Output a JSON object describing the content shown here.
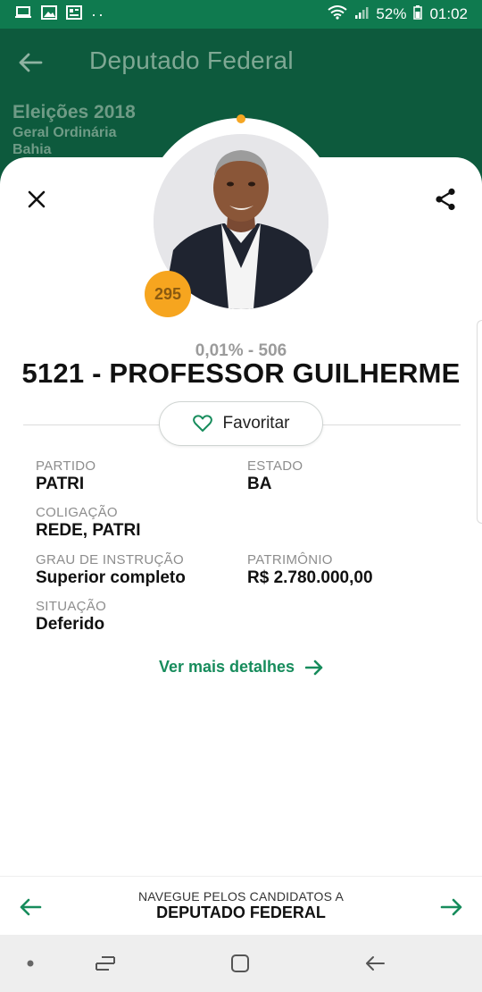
{
  "status_bar": {
    "battery_text": "52%",
    "time": "01:02",
    "icons": [
      "laptop-icon",
      "image-icon",
      "news-icon",
      "more-dots-icon",
      "wifi-icon",
      "signal-icon",
      "battery-icon"
    ]
  },
  "header": {
    "title": "Deputado Federal",
    "election_title": "Eleições 2018",
    "election_type": "Geral Ordinária",
    "election_state": "Bahia"
  },
  "candidate": {
    "rank": "295",
    "votes": "0,01% - 506",
    "name": "5121 - PROFESSOR GUILHERME",
    "favorite_label": "Favoritar",
    "fields": {
      "partido_label": "PARTIDO",
      "partido_value": "PATRI",
      "estado_label": "ESTADO",
      "estado_value": "BA",
      "coligacao_label": "COLIGAÇÃO",
      "coligacao_value": "REDE, PATRI",
      "grau_label": "GRAU DE INSTRUÇÃO",
      "grau_value": "Superior completo",
      "patrimonio_label": "PATRIMÔNIO",
      "patrimonio_value": "R$ 2.780.000,00",
      "situacao_label": "SITUAÇÃO",
      "situacao_value": "Deferido"
    },
    "more_details": "Ver mais detalhes"
  },
  "bottom_nav": {
    "caption": "NAVEGUE PELOS CANDIDATOS A",
    "title": "DEPUTADO FEDERAL"
  },
  "colors": {
    "status_green": "#0f7a4f",
    "header_green": "#0d5a3d",
    "accent_green": "#178c5c",
    "badge_orange": "#f6a51f"
  }
}
